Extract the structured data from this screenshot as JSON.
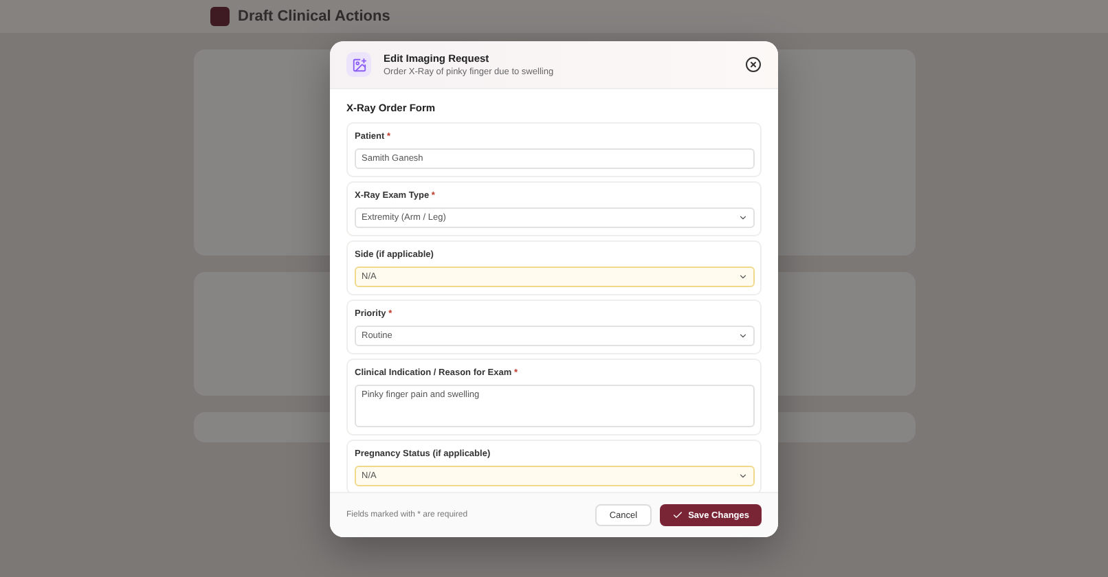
{
  "background": {
    "title": "Draft Clinical Actions"
  },
  "dialog": {
    "title": "Edit Imaging Request",
    "subtitle": "Order X-Ray of pinky finger due to swelling",
    "form_title": "X-Ray Order Form",
    "fields": [
      {
        "kind": "text",
        "label": "Patient",
        "required": true,
        "value": "Samith Ganesh",
        "highlighted": false
      },
      {
        "kind": "select",
        "label": "X-Ray Exam Type",
        "required": true,
        "value": "Extremity (Arm / Leg)",
        "highlighted": false
      },
      {
        "kind": "select",
        "label": "Side (if applicable)",
        "required": false,
        "value": "N/A",
        "highlighted": true
      },
      {
        "kind": "select",
        "label": "Priority",
        "required": true,
        "value": "Routine",
        "highlighted": false
      },
      {
        "kind": "textarea",
        "label": "Clinical Indication / Reason for Exam",
        "required": true,
        "value": "Pinky finger pain and swelling",
        "highlighted": false
      },
      {
        "kind": "select",
        "label": "Pregnancy Status (if applicable)",
        "required": false,
        "value": "N/A",
        "highlighted": true
      }
    ],
    "footer_note": "Fields marked with * are required",
    "required_mark": "*",
    "buttons": {
      "cancel": "Cancel",
      "save": "Save Changes"
    }
  }
}
